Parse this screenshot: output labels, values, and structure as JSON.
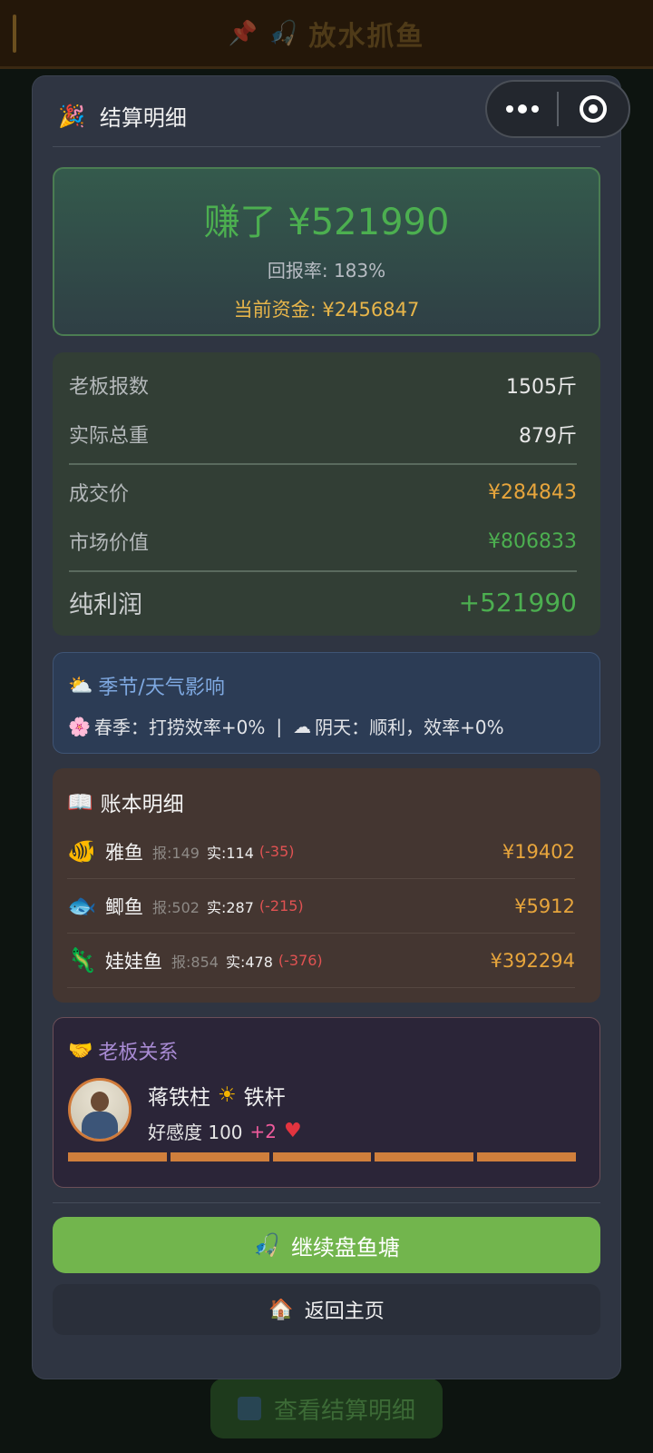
{
  "background": {
    "top_title": "放水抓鱼",
    "bottom_button": "查看结算明细"
  },
  "modal": {
    "header_icon": "party-popper-icon",
    "title": "结算明细",
    "earn": {
      "headline": "赚了 ¥521990",
      "return_rate": "回报率: 183%",
      "current_funds": "当前资金: ¥2456847"
    },
    "stats": {
      "boss_reported_label": "老板报数",
      "boss_reported_value": "1505斤",
      "actual_weight_label": "实际总重",
      "actual_weight_value": "879斤",
      "deal_price_label": "成交价",
      "deal_price_value": "¥284843",
      "market_value_label": "市场价值",
      "market_value_value": "¥806833",
      "net_profit_label": "纯利润",
      "net_profit_value": "+521990"
    },
    "weather": {
      "title": "季节/天气影响",
      "season": "春季：打捞效率+0%",
      "separator": "|",
      "weather": "阴天：顺利，效率+0%"
    },
    "ledger": {
      "title": "账本明细",
      "items": [
        {
          "icon": "tropical-fish-icon",
          "emoji": "🐠",
          "name": "雅鱼",
          "reported": "报:149",
          "actual": "实:114",
          "diff": "(-35)",
          "price": "¥19402"
        },
        {
          "icon": "fish-icon",
          "emoji": "🐟",
          "name": "鲫鱼",
          "reported": "报:502",
          "actual": "实:287",
          "diff": "(-215)",
          "price": "¥5912"
        },
        {
          "icon": "lizard-icon",
          "emoji": "🦎",
          "name": "娃娃鱼",
          "reported": "报:854",
          "actual": "实:478",
          "diff": "(-376)",
          "price": "¥392294"
        }
      ]
    },
    "boss": {
      "title": "老板关系",
      "name": "蒋铁柱",
      "tier": "铁杆",
      "favor": "好感度 100",
      "favor_delta": "+2",
      "favor_level": 1.0
    },
    "buttons": {
      "continue": "继续盘鱼塘",
      "home": "返回主页"
    }
  },
  "colors": {
    "profit_green": "#4caf50",
    "money_orange": "#e7a53c",
    "loss_red": "#e05252",
    "continue_button": "#72b54d"
  }
}
